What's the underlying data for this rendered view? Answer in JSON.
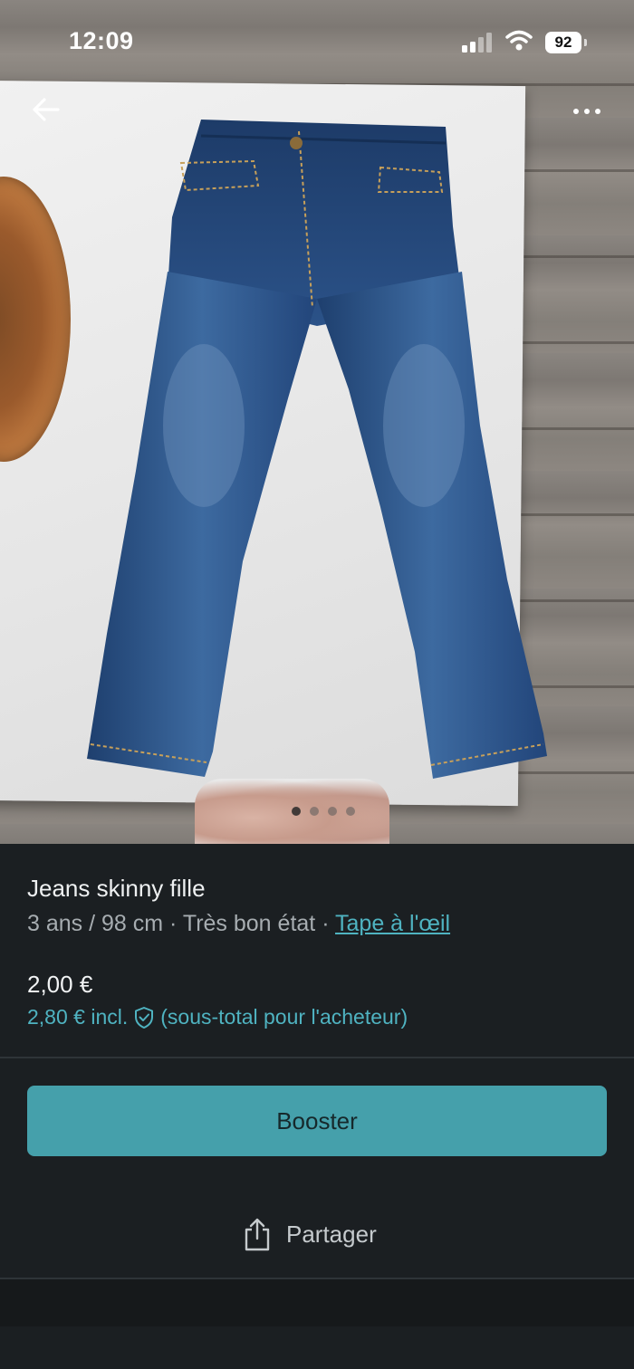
{
  "status_bar": {
    "time": "12:09",
    "battery": "92"
  },
  "photo": {
    "page_count": 4,
    "active_index": 0
  },
  "listing": {
    "title": "Jeans skinny fille",
    "size": "3 ans / 98 cm",
    "condition": "Très bon état",
    "brand": "Tape à l'œil",
    "separator": "·",
    "price": "2,00 €",
    "price_incl": "2,80 € incl.",
    "price_incl_note": "(sous-total pour l'acheteur)"
  },
  "actions": {
    "booster_label": "Booster",
    "share_label": "Partager"
  },
  "colors": {
    "accent": "#45a0ab",
    "link": "#4fb3c1",
    "background": "#1b1f22"
  }
}
